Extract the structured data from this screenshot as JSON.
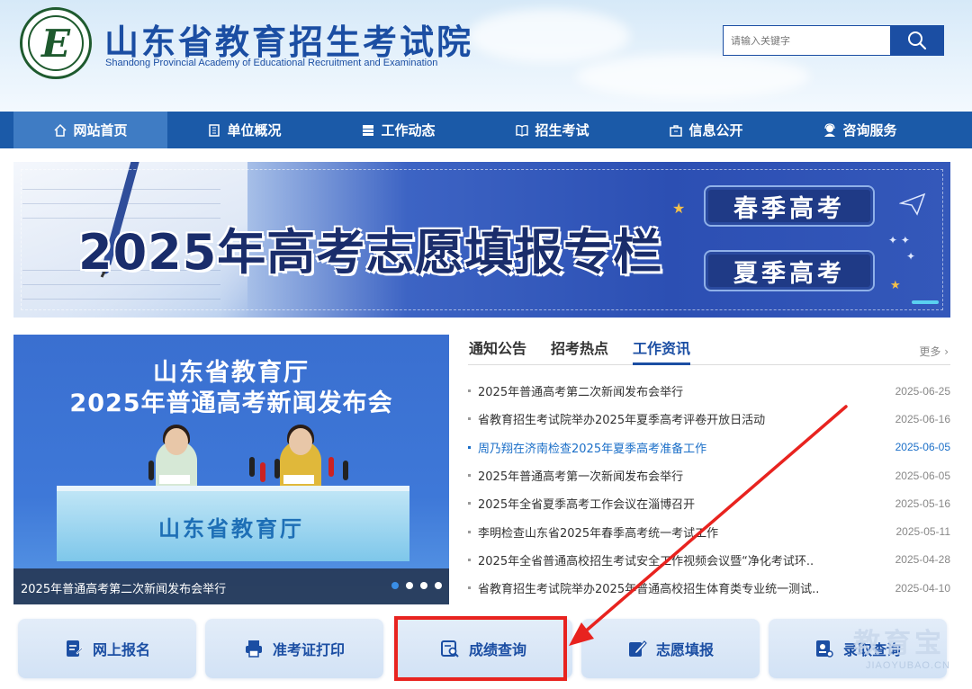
{
  "header": {
    "title": "山东省教育招生考试院",
    "subtitle": "Shandong Provincial Academy of Educational Recruitment and Examination",
    "logo_letter": "E",
    "search_placeholder": "请输入关键字"
  },
  "nav": {
    "items": [
      {
        "label": "网站首页",
        "icon": "home-icon",
        "active": true
      },
      {
        "label": "单位概况",
        "icon": "building-icon",
        "active": false
      },
      {
        "label": "工作动态",
        "icon": "news-icon",
        "active": false
      },
      {
        "label": "招生考试",
        "icon": "book-icon",
        "active": false
      },
      {
        "label": "信息公开",
        "icon": "briefcase-icon",
        "active": false
      },
      {
        "label": "咨询服务",
        "icon": "support-icon",
        "active": false
      }
    ]
  },
  "banner": {
    "title": "2025年高考志愿填报专栏",
    "spring_button": "春季高考",
    "summer_button": "夏季高考"
  },
  "slideshow": {
    "line1": "山东省教育厅",
    "line2": "2025年普通高考新闻发布会",
    "desk_text": "山东省教育厅",
    "caption": "2025年普通高考第二次新闻发布会举行",
    "slide_count": 4,
    "current_slide": 1
  },
  "news": {
    "tabs": [
      "通知公告",
      "招考热点",
      "工作资讯"
    ],
    "active_tab": "工作资讯",
    "more": "更多",
    "items": [
      {
        "title": "2025年普通高考第二次新闻发布会举行",
        "date": "2025-06-25"
      },
      {
        "title": "省教育招生考试院举办2025年夏季高考评卷开放日活动",
        "date": "2025-06-16"
      },
      {
        "title": "周乃翔在济南检查2025年夏季高考准备工作",
        "date": "2025-06-05"
      },
      {
        "title": "2025年普通高考第一次新闻发布会举行",
        "date": "2025-06-05"
      },
      {
        "title": "2025年全省夏季高考工作会议在淄博召开",
        "date": "2025-05-16"
      },
      {
        "title": "李明检查山东省2025年春季高考统一考试工作",
        "date": "2025-05-11"
      },
      {
        "title": "2025年全省普通高校招生考试安全工作视频会议暨“净化考试环..",
        "date": "2025-04-28"
      },
      {
        "title": "省教育招生考试院举办2025年普通高校招生体育类专业统一测试..",
        "date": "2025-04-10"
      }
    ]
  },
  "services": [
    {
      "label": "网上报名",
      "icon": "form-icon"
    },
    {
      "label": "准考证打印",
      "icon": "printer-icon"
    },
    {
      "label": "成绩查询",
      "icon": "score-search-icon"
    },
    {
      "label": "志愿填报",
      "icon": "edit-icon"
    },
    {
      "label": "录取查询",
      "icon": "admission-icon"
    }
  ],
  "watermark": {
    "text": "教育宝",
    "url": "JIAOYUBAO.CN"
  },
  "colors": {
    "brand": "#1b4ea3",
    "nav": "#1b5aa8",
    "annotation": "#e8231f"
  }
}
